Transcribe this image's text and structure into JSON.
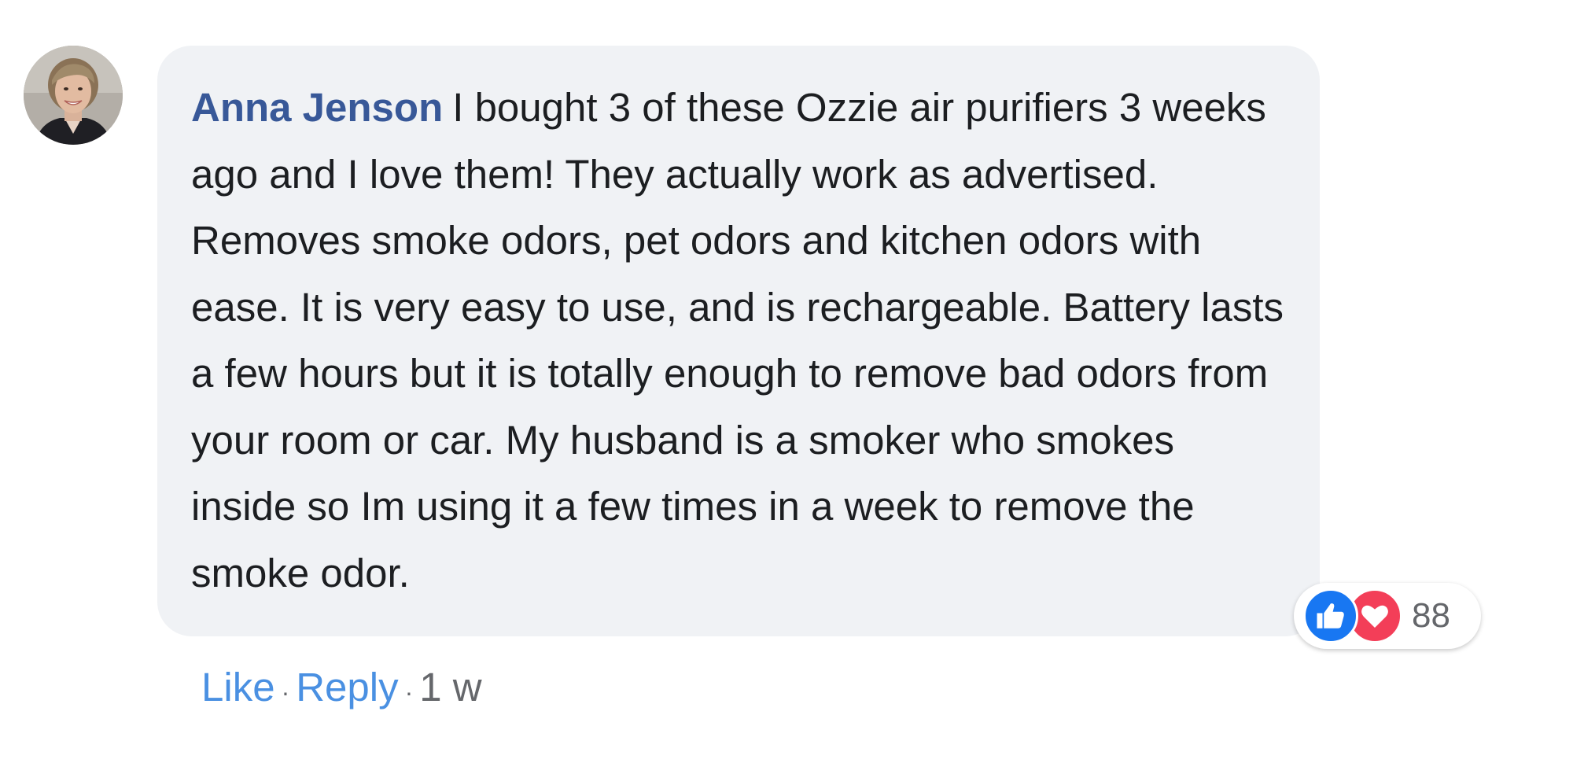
{
  "comment": {
    "author": "Anna Jenson",
    "text": "I bought 3 of these Ozzie air purifiers 3 weeks ago and I love them! They actually work as advertised. Removes smoke odors, pet odors and kitchen odors with ease. It is very easy to use, and is rechargeable. Battery lasts a few hours but it is totally enough to remove bad odors from your room or car. My husband is a smoker who smokes inside so Im using it a few times in a week to remove the smoke odor.",
    "reactions": {
      "icons": [
        "like-icon",
        "love-icon"
      ],
      "count": "88"
    },
    "actions": {
      "like_label": "Like",
      "separator": "·",
      "reply_label": "Reply",
      "timestamp": "1 w"
    }
  },
  "colors": {
    "author": "#385898",
    "bubble_bg": "#f0f2f5",
    "action_link": "#4a90e2",
    "like_blue": "#1877f2",
    "love_red": "#f33e58",
    "muted_text": "#65676b"
  }
}
